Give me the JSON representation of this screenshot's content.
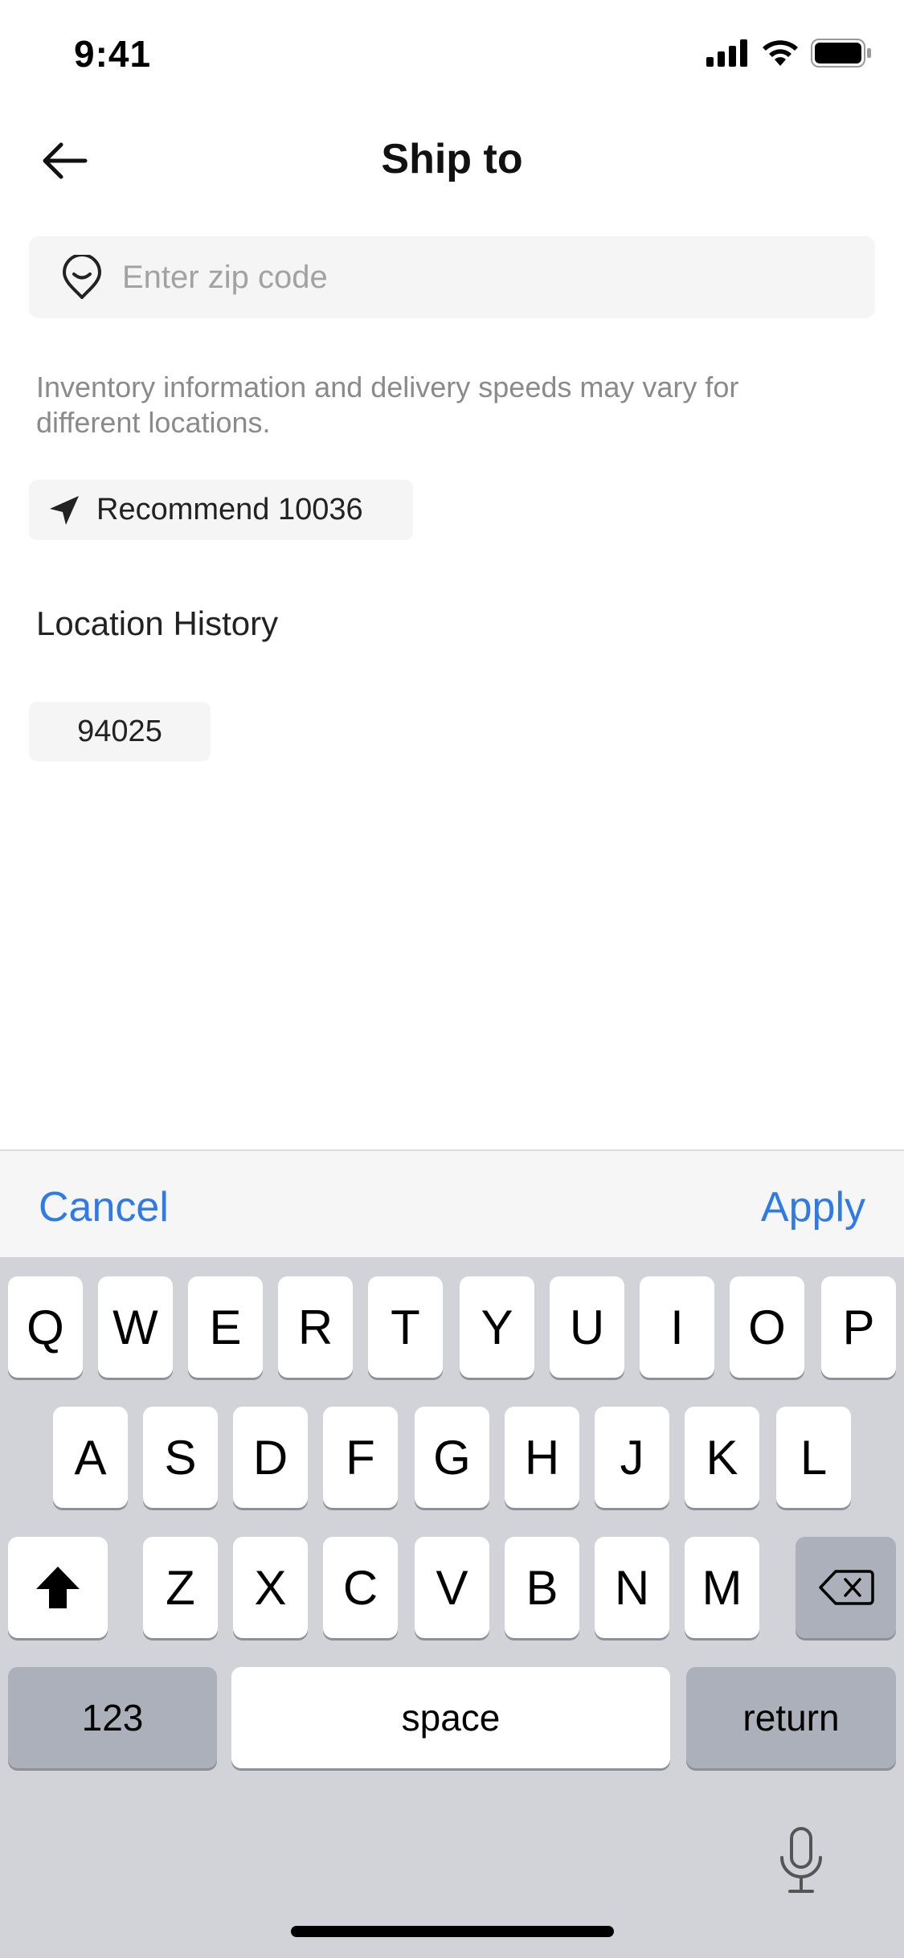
{
  "status": {
    "time": "9:41"
  },
  "nav": {
    "title": "Ship to"
  },
  "search": {
    "placeholder": "Enter zip code",
    "value": ""
  },
  "info_text": "Inventory information and delivery speeds may vary for different locations.",
  "recommend": {
    "label": "Recommend 10036"
  },
  "history": {
    "title": "Location History",
    "items": [
      "94025"
    ]
  },
  "toolbar": {
    "cancel": "Cancel",
    "apply": "Apply"
  },
  "keyboard": {
    "row1": [
      "Q",
      "W",
      "E",
      "R",
      "T",
      "Y",
      "U",
      "I",
      "O",
      "P"
    ],
    "row2": [
      "A",
      "S",
      "D",
      "F",
      "G",
      "H",
      "J",
      "K",
      "L"
    ],
    "row3": [
      "Z",
      "X",
      "C",
      "V",
      "B",
      "N",
      "M"
    ],
    "numbers": "123",
    "space": "space",
    "return": "return"
  },
  "colors": {
    "accent": "#2f7ae5"
  }
}
